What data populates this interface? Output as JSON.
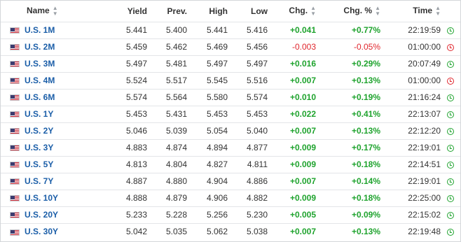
{
  "header": {
    "name": "Name",
    "yield": "Yield",
    "prev": "Prev.",
    "high": "High",
    "low": "Low",
    "chg": "Chg.",
    "chg_pct": "Chg. %",
    "time": "Time",
    "sort_icon": "sort-arrows-icon"
  },
  "colors": {
    "positive": "#1fa32e",
    "negative": "#e0262d",
    "link": "#1b5ea8"
  },
  "rows": [
    {
      "name": "U.S. 1M",
      "yield": "5.441",
      "prev": "5.400",
      "high": "5.441",
      "low": "5.416",
      "chg": "+0.041",
      "chg_pct": "+0.77%",
      "time": "22:19:59",
      "direction": "up",
      "market": "open"
    },
    {
      "name": "U.S. 2M",
      "yield": "5.459",
      "prev": "5.462",
      "high": "5.469",
      "low": "5.456",
      "chg": "-0.003",
      "chg_pct": "-0.05%",
      "time": "01:00:00",
      "direction": "down",
      "market": "closed"
    },
    {
      "name": "U.S. 3M",
      "yield": "5.497",
      "prev": "5.481",
      "high": "5.497",
      "low": "5.497",
      "chg": "+0.016",
      "chg_pct": "+0.29%",
      "time": "20:07:49",
      "direction": "up",
      "market": "open"
    },
    {
      "name": "U.S. 4M",
      "yield": "5.524",
      "prev": "5.517",
      "high": "5.545",
      "low": "5.516",
      "chg": "+0.007",
      "chg_pct": "+0.13%",
      "time": "01:00:00",
      "direction": "up",
      "market": "closed"
    },
    {
      "name": "U.S. 6M",
      "yield": "5.574",
      "prev": "5.564",
      "high": "5.580",
      "low": "5.574",
      "chg": "+0.010",
      "chg_pct": "+0.19%",
      "time": "21:16:24",
      "direction": "up",
      "market": "open"
    },
    {
      "name": "U.S. 1Y",
      "yield": "5.453",
      "prev": "5.431",
      "high": "5.453",
      "low": "5.453",
      "chg": "+0.022",
      "chg_pct": "+0.41%",
      "time": "22:13:07",
      "direction": "up",
      "market": "open"
    },
    {
      "name": "U.S. 2Y",
      "yield": "5.046",
      "prev": "5.039",
      "high": "5.054",
      "low": "5.040",
      "chg": "+0.007",
      "chg_pct": "+0.13%",
      "time": "22:12:20",
      "direction": "up",
      "market": "open"
    },
    {
      "name": "U.S. 3Y",
      "yield": "4.883",
      "prev": "4.874",
      "high": "4.894",
      "low": "4.877",
      "chg": "+0.009",
      "chg_pct": "+0.17%",
      "time": "22:19:01",
      "direction": "up",
      "market": "open"
    },
    {
      "name": "U.S. 5Y",
      "yield": "4.813",
      "prev": "4.804",
      "high": "4.827",
      "low": "4.811",
      "chg": "+0.009",
      "chg_pct": "+0.18%",
      "time": "22:14:51",
      "direction": "up",
      "market": "open"
    },
    {
      "name": "U.S. 7Y",
      "yield": "4.887",
      "prev": "4.880",
      "high": "4.904",
      "low": "4.886",
      "chg": "+0.007",
      "chg_pct": "+0.14%",
      "time": "22:19:01",
      "direction": "up",
      "market": "open"
    },
    {
      "name": "U.S. 10Y",
      "yield": "4.888",
      "prev": "4.879",
      "high": "4.906",
      "low": "4.882",
      "chg": "+0.009",
      "chg_pct": "+0.18%",
      "time": "22:25:00",
      "direction": "up",
      "market": "open"
    },
    {
      "name": "U.S. 20Y",
      "yield": "5.233",
      "prev": "5.228",
      "high": "5.256",
      "low": "5.230",
      "chg": "+0.005",
      "chg_pct": "+0.09%",
      "time": "22:15:02",
      "direction": "up",
      "market": "open"
    },
    {
      "name": "U.S. 30Y",
      "yield": "5.042",
      "prev": "5.035",
      "high": "5.062",
      "low": "5.038",
      "chg": "+0.007",
      "chg_pct": "+0.13%",
      "time": "22:19:48",
      "direction": "up",
      "market": "open"
    }
  ]
}
